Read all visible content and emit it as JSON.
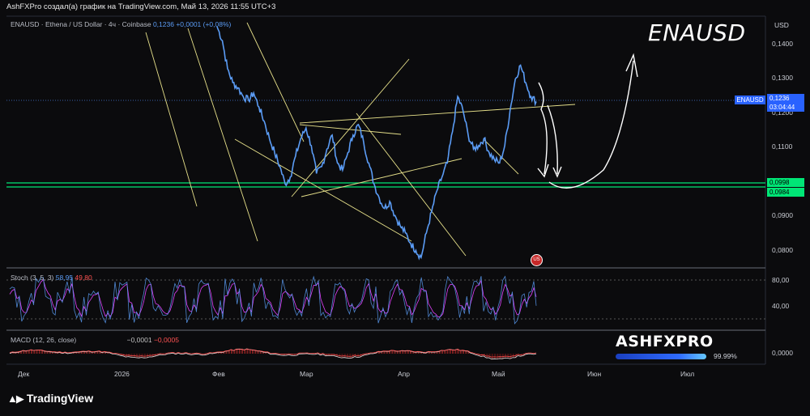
{
  "header": {
    "caption": "AshFXPro создал(а) график на TradingView.com, Май 13, 2026 11:55 UTC+3"
  },
  "legend": {
    "symbol_desc": "ENAUSD · Ethena / US Dollar · 4ч · Coinbase",
    "price": "0,1236",
    "change": "+0,0001 (+0,08%)"
  },
  "annotation_title": "ENAUSD",
  "price_axis": {
    "unit": "USD",
    "ticks": [
      "0,1400",
      "0,1300",
      "0,1200",
      "0,1100",
      "0,0998",
      "0,0984",
      "0,0900",
      "0,0800"
    ]
  },
  "price_label": {
    "symbol": "ENAUSD",
    "price": "0,1236",
    "countdown": "03:04:44"
  },
  "support_labels": [
    "0,0998",
    "0,0984"
  ],
  "stoch": {
    "name": "Stoch (3, 5, 3)",
    "k": "58,95",
    "d": "49,80",
    "ticks": [
      "80,00",
      "40,00"
    ]
  },
  "macd": {
    "name": "MACD (12, 26, close)",
    "value1": "−0,0001",
    "value2": "−0,0005",
    "tick": "0,0000"
  },
  "time_axis": [
    "Дек",
    "2026",
    "Фев",
    "Мар",
    "Апр",
    "Май",
    "Июн",
    "Июл"
  ],
  "watermark": {
    "brand": "ASHFXPRO",
    "percent": "99.99%"
  },
  "footer": {
    "logo_text": "TradingView"
  },
  "colors": {
    "price_line": "#5b9cf5",
    "trendline": "#e6e08a",
    "support": "#00e676",
    "stoch_k": "#5b9cf5",
    "stoch_d": "#e040fb",
    "macd_hist": "#8b1a1a"
  },
  "chart_data": {
    "type": "line",
    "x": [
      "Дек",
      "2026",
      "Фев",
      "Мар",
      "Апр",
      "Май",
      "Июн",
      "Июл"
    ],
    "ylim": [
      0.076,
      0.148
    ],
    "price_series": [
      0.145,
      0.141,
      0.133,
      0.129,
      0.1275,
      0.125,
      0.124,
      0.126,
      0.122,
      0.118,
      0.113,
      0.109,
      0.105,
      0.1,
      0.102,
      0.108,
      0.113,
      0.116,
      0.111,
      0.103,
      0.105,
      0.11,
      0.114,
      0.106,
      0.104,
      0.109,
      0.114,
      0.117,
      0.112,
      0.106,
      0.1,
      0.096,
      0.093,
      0.095,
      0.091,
      0.088,
      0.086,
      0.083,
      0.081,
      0.079,
      0.086,
      0.092,
      0.098,
      0.102,
      0.106,
      0.115,
      0.125,
      0.121,
      0.114,
      0.11,
      0.111,
      0.113,
      0.109,
      0.107,
      0.106,
      0.111,
      0.121,
      0.13,
      0.134,
      0.129,
      0.125,
      0.1236
    ],
    "support_zone": [
      0.0984,
      0.0998
    ]
  }
}
